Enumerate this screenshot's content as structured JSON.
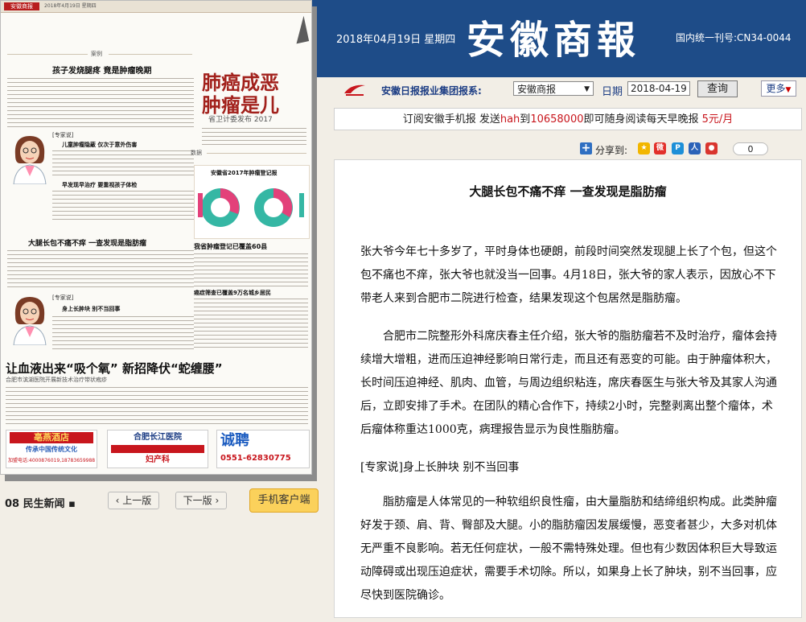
{
  "masthead": {
    "date": "2018年04月19日 星期四",
    "title": "安徽商報",
    "code": "国内统一刊号:CN34-0044"
  },
  "nav": {
    "group_label": "安徽日报报业集团报系:",
    "paper_selected": "安徽商报",
    "date_label": "日期",
    "date_value": "2018-04-19",
    "query_button": "查询",
    "more_button": "更多"
  },
  "promo": {
    "part1": "订阅安徽手机报  发送",
    "code": "hah",
    "part2": "到",
    "number": "10658000",
    "part3": "即可随身阅读每天早晚报  ",
    "price": "5元/月"
  },
  "share": {
    "label": "分享到:",
    "count": "0",
    "icons": [
      "qzone-icon",
      "weibo-icon",
      "tencent-weibo-icon",
      "renren-icon",
      "sina-icon"
    ]
  },
  "article": {
    "title": "大腿长包不痛不痒 一查发现是脂肪瘤",
    "para1": "张大爷今年七十多岁了，平时身体也硬朗，前段时间突然发现腿上长了个包，但这个包不痛也不痒，张大爷也就没当一回事。4月18日，张大爷的家人表示，因放心不下带老人来到合肥市二院进行检查，结果发现这个包居然是脂肪瘤。",
    "para2": "合肥市二院整形外科席庆春主任介绍，张大爷的脂肪瘤若不及时治疗，瘤体会持续增大增粗，进而压迫神经影响日常行走，而且还有恶变的可能。由于肿瘤体积大，长时间压迫神经、肌肉、血管，与周边组织粘连，席庆春医生与张大爷及其家人沟通后，立即安排了手术。在团队的精心合作下，持续2小时，完整剥离出整个瘤体，术后瘤体称重达1000克，病理报告显示为良性脂肪瘤。",
    "subhead": "[专家说]身上长肿块 别不当回事",
    "para3": "脂肪瘤是人体常见的一种软组织良性瘤，由大量脂肪和结缔组织构成。此类肿瘤好发于颈、肩、背、臀部及大腿。小的脂肪瘤因发展缓慢，恶变者甚少，大多对机体无严重不良影响。若无任何症状，一般不需特殊处理。但也有少数因体积巨大导致运动障碍或出现压迫症状，需要手术切除。所以，如果身上长了肿块，别不当回事，应尽快到医院确诊。"
  },
  "thumbnail": {
    "brand": "安徽商报",
    "header_date": "2018年4月19日 星期四",
    "section_case": "案例",
    "section_data": "数据",
    "headline1": "孩子发烧腿疼 竟是肿瘤晚期",
    "expert1": "[专家说]",
    "sub1": "儿童肿瘤隐蔽 仅次于意外伤害",
    "sub2": "早发现早治疗 要重视孩子体检",
    "headline2": "大腿长包不痛不痒 一查发现是脂肪瘤",
    "expert2": "[专家说]",
    "sub3": "身上长肿块 别不当回事",
    "big_title_line1": "肺癌成恶",
    "big_title_line2": "肿瘤是儿",
    "big_sub": "省卫计委发布 2017",
    "chart_title": "安徽省2017年肿瘤登记报",
    "news_head1": "我省肿瘤登记已覆盖60县",
    "news_head2": "癌症筛查已覆盖9万名城乡居民",
    "banner_title": "让血液出来“吸个氧” 新招降伏“蛇缠腰”",
    "banner_sub": "合肥市滨湖医院开展新技术治疗带状疱疹",
    "ad1_title": "亳燕酒店",
    "ad1_sub": "传承中国传统文化",
    "ad1_phone": "加盟电话:4000876019,18783659988",
    "ad2_title": "合肥长江医院",
    "ad2_sub": "妇产科",
    "ad3_title": "诚聘",
    "ad3_phone": "0551-62830775"
  },
  "pager": {
    "page_label": "08 民生新闻 ▪",
    "prev_button": "上一版",
    "next_button": "下一版",
    "client_button": "手机客户端"
  },
  "colors": {
    "masthead_bg": "#1e4c88",
    "accent_red": "#c8161d",
    "page_bg": "#f2eee6",
    "client_button": "#fbd15b"
  }
}
